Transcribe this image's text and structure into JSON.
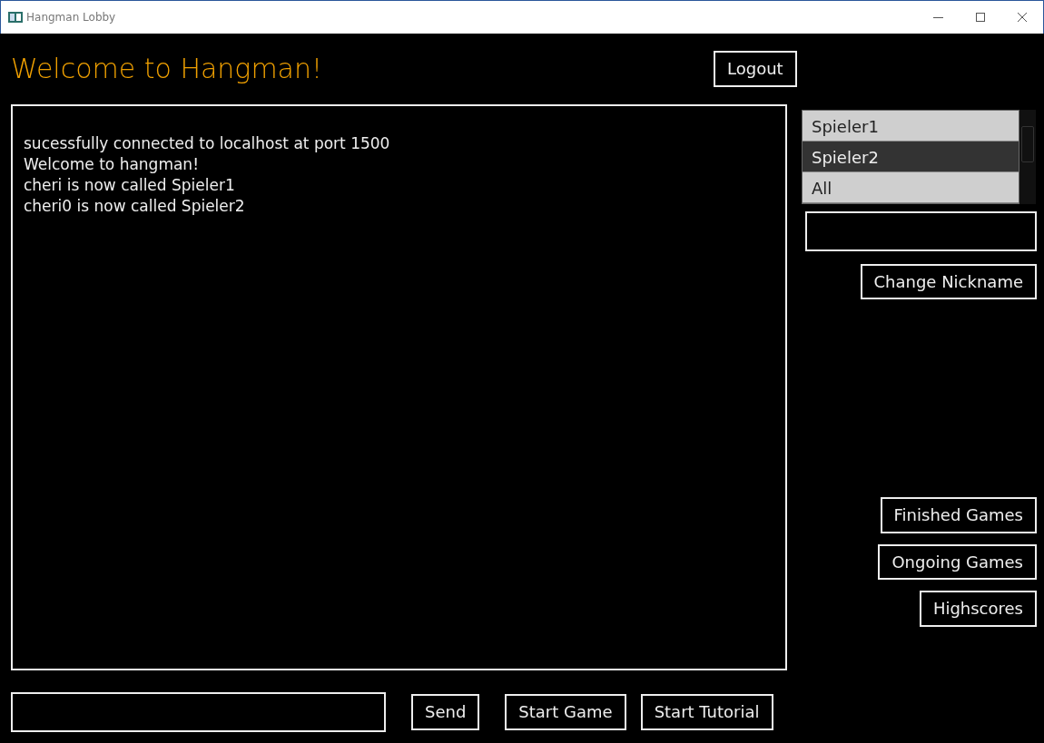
{
  "window": {
    "title": "Hangman Lobby"
  },
  "heading": "Welcome to Hangman!",
  "logout_button": "Logout",
  "chat_messages": [
    "sucessfully connected to localhost at port 1500",
    "Welcome to hangman!",
    "cheri is now called Spieler1",
    "cheri0 is now called Spieler2"
  ],
  "players": [
    {
      "name": "Spieler1",
      "selected": false
    },
    {
      "name": "Spieler2",
      "selected": true
    },
    {
      "name": "All",
      "selected": false
    }
  ],
  "change_nickname_button": "Change Nickname",
  "side_buttons": [
    "Finished Games",
    "Ongoing Games",
    "Highscores"
  ],
  "send_button": "Send",
  "start_game_button": "Start Game",
  "start_tutorial_button": "Start Tutorial"
}
